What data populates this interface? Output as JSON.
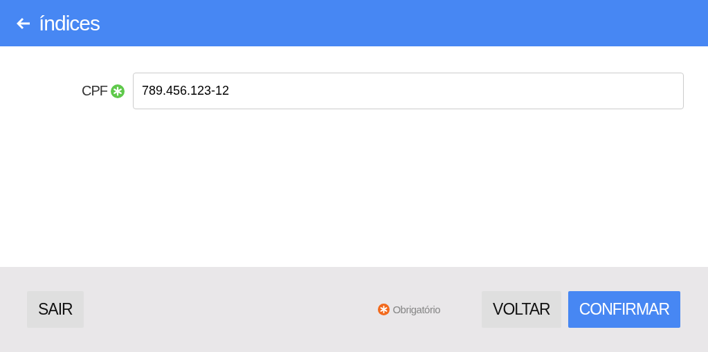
{
  "header": {
    "title": "índices"
  },
  "form": {
    "fields": [
      {
        "label": "CPF",
        "required": true,
        "value": "789.456.123-12"
      }
    ]
  },
  "footer": {
    "buttons": [
      {
        "label": "SAIR",
        "kind": "secondary"
      }
    ],
    "legend": "Obrigatório",
    "actions": [
      {
        "label": "VOLTAR",
        "kind": "secondary"
      },
      {
        "label": "CONFIRMAR",
        "kind": "primary"
      }
    ]
  }
}
